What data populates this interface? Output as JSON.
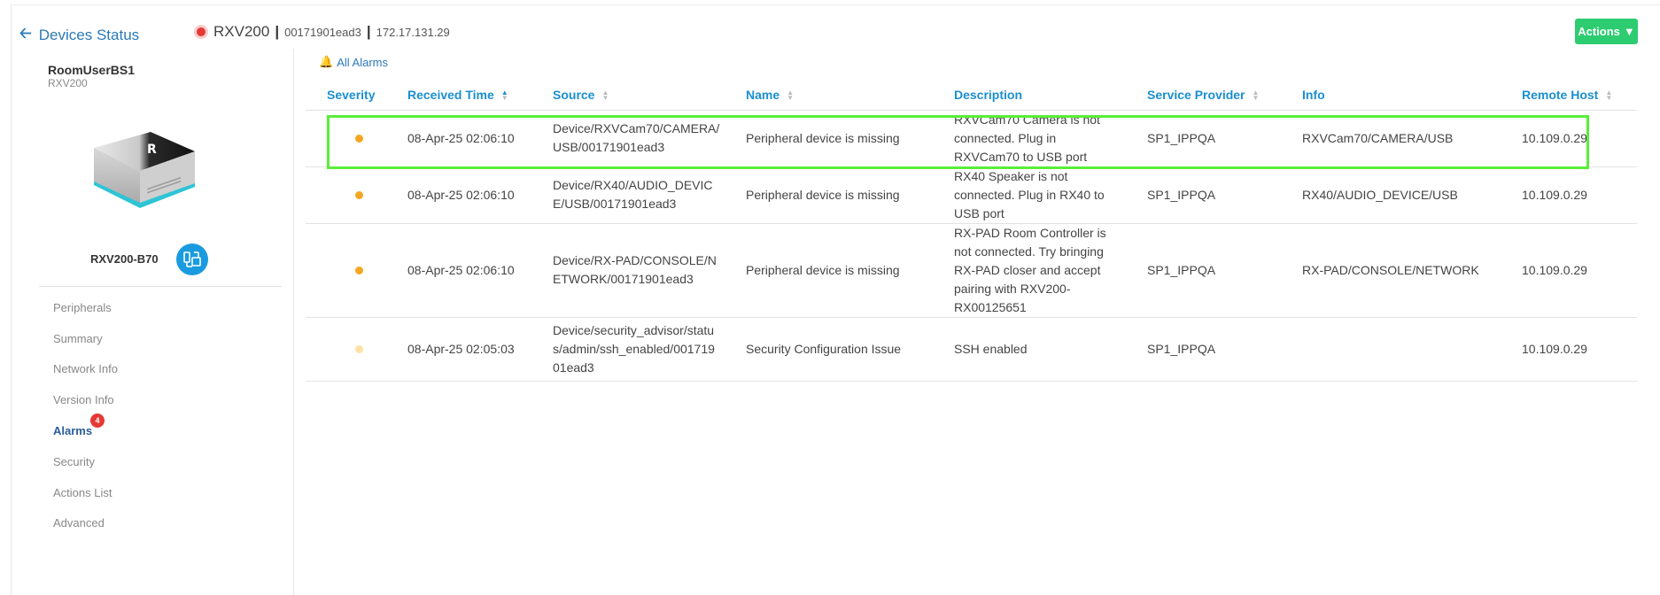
{
  "header": {
    "back_label": "Devices Status",
    "device_model": "RXV200",
    "mac": "00171901ead3",
    "ip": "172.17.131.29",
    "separator": "|",
    "actions_label": "Actions"
  },
  "device": {
    "room_name": "RoomUserBS1",
    "model": "RXV200",
    "id_label": "RXV200-B70"
  },
  "menu": {
    "items": [
      {
        "label": "Peripherals"
      },
      {
        "label": "Summary"
      },
      {
        "label": "Network Info"
      },
      {
        "label": "Version Info"
      },
      {
        "label": "Alarms"
      },
      {
        "label": "Security"
      },
      {
        "label": "Actions List"
      },
      {
        "label": "Advanced"
      }
    ],
    "alarms_badge": "4"
  },
  "alarms": {
    "title": "All Alarms",
    "columns": [
      "Severity",
      "Received Time",
      "Source",
      "Name",
      "Description",
      "Service Provider",
      "Info",
      "Remote Host"
    ],
    "rows": [
      {
        "severity_color": "#f5a623",
        "received": "08-Apr-25 02:06:10",
        "source": "Device/RXVCam70/CAMERA/USB/00171901ead3",
        "name": "Peripheral device is missing",
        "description": "RXVCam70 Camera is not connected. Plug in RXVCam70 to USB port",
        "provider": "SP1_IPPQA",
        "info": "RXVCam70/CAMERA/USB",
        "host": "10.109.0.29"
      },
      {
        "severity_color": "#f5a623",
        "received": "08-Apr-25 02:06:10",
        "source": "Device/RX40/AUDIO_DEVICE/USB/00171901ead3",
        "name": "Peripheral device is missing",
        "description": "RX40 Speaker is not connected. Plug in RX40 to USB port",
        "provider": "SP1_IPPQA",
        "info": "RX40/AUDIO_DEVICE/USB",
        "host": "10.109.0.29"
      },
      {
        "severity_color": "#f5a623",
        "received": "08-Apr-25 02:06:10",
        "source": "Device/RX-PAD/CONSOLE/NETWORK/00171901ead3",
        "name": "Peripheral device is missing",
        "description": "RX-PAD Room Controller is not connected. Try bringing RX-PAD closer and accept pairing with RXV200-RX00125651",
        "provider": "SP1_IPPQA",
        "info": "RX-PAD/CONSOLE/NETWORK",
        "host": "10.109.0.29"
      },
      {
        "severity_color": "#fbe3a8",
        "received": "08-Apr-25 02:05:03",
        "source": "Device/security_advisor/status/admin/ssh_enabled/00171901ead3",
        "name": "Security Configuration Issue",
        "description": "SSH enabled",
        "provider": "SP1_IPPQA",
        "info": "",
        "host": "10.109.0.29"
      }
    ]
  },
  "colors": {
    "accent": "#1a8fd0",
    "actions": "#2ecc71",
    "status_offline": "#e53935",
    "highlight": "#5aee3a"
  }
}
